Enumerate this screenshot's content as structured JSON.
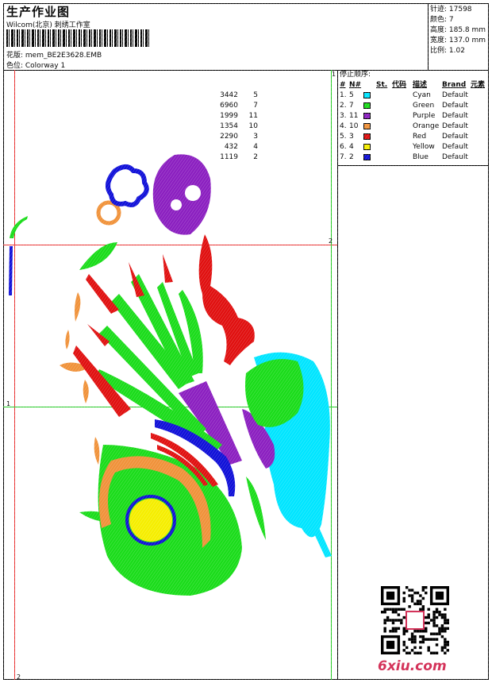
{
  "header": {
    "title": "生产作业图",
    "subtitle": "Wilcom(北京) 刺绣工作室",
    "design_name": "花版: mem_BE2E3628.EMB",
    "colorway": "色位: Colorway 1"
  },
  "stats": {
    "stitches": "针迹: 17598",
    "colors": "颜色: 7",
    "height": "高度: 185.8 mm",
    "width": "宽度: 137.0 mm",
    "scale": "比例: 1.02"
  },
  "stop_sequence": {
    "title": "停止顺序:",
    "headers": {
      "hash": "#",
      "n": "N#",
      "st": "St.",
      "code": "代码",
      "desc": "描述",
      "brand": "Brand",
      "element": "元素"
    },
    "rows": [
      {
        "idx": "1.",
        "n": "5",
        "color": "#00e5ff",
        "st": "3442",
        "code": "5",
        "desc": "Cyan",
        "brand": "Default"
      },
      {
        "idx": "2.",
        "n": "7",
        "color": "#1adc1a",
        "st": "6960",
        "code": "7",
        "desc": "Green",
        "brand": "Default"
      },
      {
        "idx": "3.",
        "n": "11",
        "color": "#8b1fc0",
        "st": "1999",
        "code": "11",
        "desc": "Purple",
        "brand": "Default"
      },
      {
        "idx": "4.",
        "n": "10",
        "color": "#f0923a",
        "st": "1354",
        "code": "10",
        "desc": "Orange",
        "brand": "Default"
      },
      {
        "idx": "5.",
        "n": "3",
        "color": "#e01010",
        "st": "2290",
        "code": "3",
        "desc": "Red",
        "brand": "Default"
      },
      {
        "idx": "6.",
        "n": "4",
        "color": "#f5ee00",
        "st": "432",
        "code": "4",
        "desc": "Yellow",
        "brand": "Default"
      },
      {
        "idx": "7.",
        "n": "2",
        "color": "#1010d8",
        "st": "1119",
        "code": "2",
        "desc": "Blue",
        "brand": "Default"
      }
    ]
  },
  "grid_labels": {
    "top": "1",
    "right": "2",
    "left": "1",
    "bottom": "2"
  },
  "watermark": "6xiu.com"
}
